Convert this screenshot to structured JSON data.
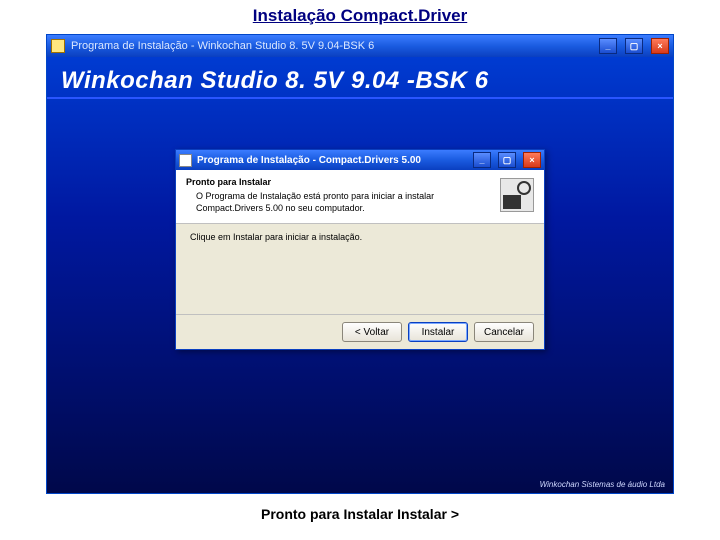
{
  "page": {
    "title": "Instalação Compact.Driver",
    "caption": "Pronto para Instalar Instalar >"
  },
  "outerWindow": {
    "title": "Programa de Instalação - Winkochan Studio 8. 5V 9.04-BSK 6",
    "banner": "Winkochan Studio 8. 5V 9.04 -BSK 6",
    "footer": "Winkochan Sistemas de áudio Ltda"
  },
  "innerWindow": {
    "title": "Programa de Instalação - Compact.Drivers 5.00",
    "header": {
      "title": "Pronto para Instalar",
      "subtitle": "O Programa de Instalação está pronto para iniciar a instalar Compact.Drivers 5.00 no seu computador."
    },
    "body": {
      "text": "Clique em Instalar para iniciar a instalação."
    },
    "buttons": {
      "back": "< Voltar",
      "install": "Instalar",
      "cancel": "Cancelar"
    }
  }
}
